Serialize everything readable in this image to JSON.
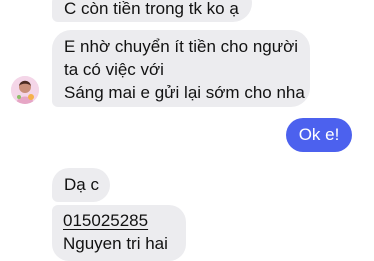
{
  "messages": [
    {
      "lines": [
        "C còn tiền trong tk ko ạ"
      ]
    },
    {
      "lines": [
        "E nhờ chuyển ít tiền cho người",
        "ta có việc với",
        "Sáng mai e gửi lại sớm cho nha"
      ]
    },
    {
      "text": "Ok e!"
    },
    {
      "text": "Dạ c"
    },
    {
      "lines": [
        "015025285",
        "Nguyen tri hai"
      ]
    }
  ],
  "colors": {
    "incoming_bubble": "#ececef",
    "outgoing_bubble": "#4c61ee",
    "text": "#121212"
  },
  "icons": {
    "avatar": "contact-avatar"
  }
}
